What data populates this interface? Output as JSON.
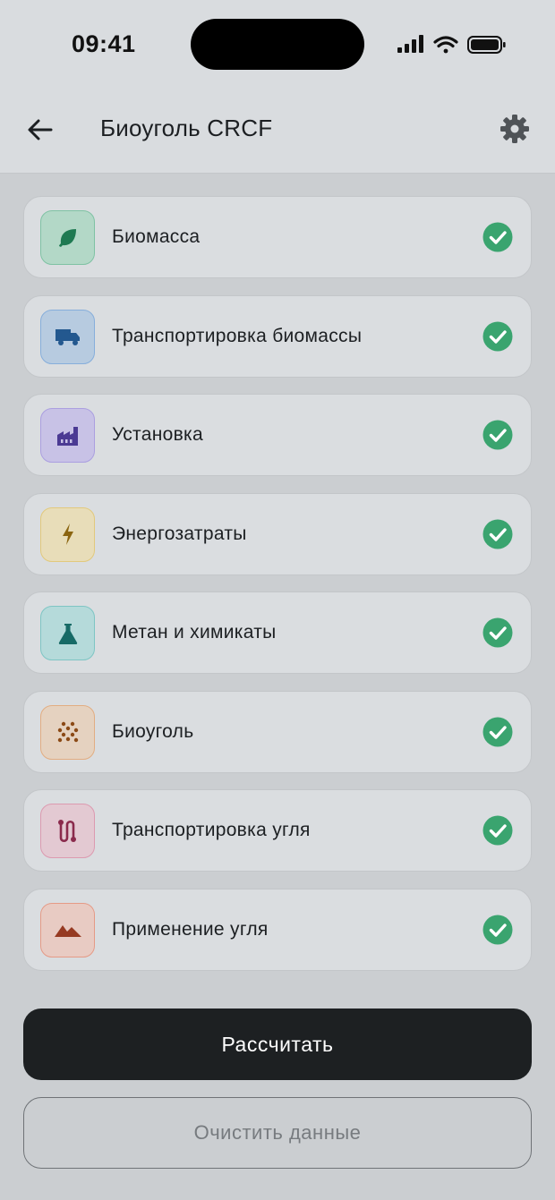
{
  "status_bar": {
    "time": "09:41"
  },
  "app_bar": {
    "title": "Биоуголь CRCF"
  },
  "steps": [
    {
      "label": "Биомасса",
      "icon": "leaf-icon",
      "bg": "#b3d8c7",
      "border": "#7fc2a4",
      "fg": "#1f7a52",
      "done": true
    },
    {
      "label": "Транспортировка биомассы",
      "icon": "truck-icon",
      "bg": "#b7cbe0",
      "border": "#86aedb",
      "fg": "#23588f",
      "done": true
    },
    {
      "label": "Установка",
      "icon": "factory-icon",
      "bg": "#c8c2e6",
      "border": "#ab9fe0",
      "fg": "#4b3a93",
      "done": true
    },
    {
      "label": "Энергозатраты",
      "icon": "lightning-icon",
      "bg": "#e8ddb9",
      "border": "#e2c97c",
      "fg": "#8b6510",
      "done": true
    },
    {
      "label": "Метан и химикаты",
      "icon": "flask-icon",
      "bg": "#b5dada",
      "border": "#7ec5c4",
      "fg": "#176a66",
      "done": true
    },
    {
      "label": "Биоуголь",
      "icon": "granules-icon",
      "bg": "#e5d2c0",
      "border": "#e2ad82",
      "fg": "#8b4a16",
      "done": true
    },
    {
      "label": "Транспортировка угля",
      "icon": "route-icon",
      "bg": "#e3c9d2",
      "border": "#dc9ab0",
      "fg": "#8a2a4c",
      "done": true
    },
    {
      "label": "Применение угля",
      "icon": "mountain-icon",
      "bg": "#e8cbc3",
      "border": "#e59a86",
      "fg": "#963a22",
      "done": true
    }
  ],
  "check_color": "#3aa46f",
  "actions": {
    "calculate_label": "Рассчитать",
    "clear_label": "Очистить данные"
  }
}
